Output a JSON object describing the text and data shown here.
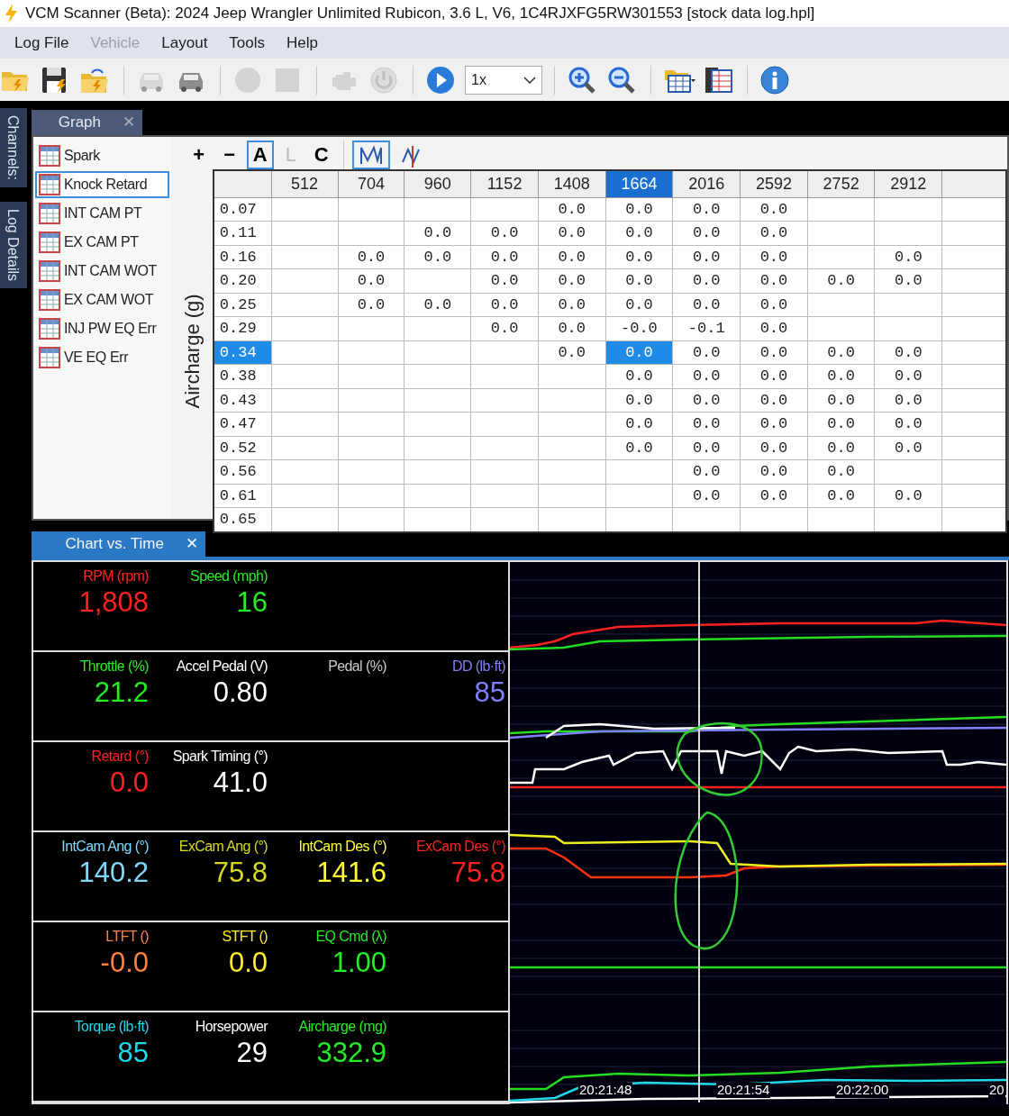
{
  "window": {
    "title": "VCM Scanner (Beta): 2024 Jeep Wrangler Unlimited Rubicon, 3.6 L, V6, 1C4RJXFG5RW301553 [stock data log.hpl]"
  },
  "menu": [
    {
      "label": "Log File",
      "disabled": false
    },
    {
      "label": "Vehicle",
      "disabled": true
    },
    {
      "label": "Layout",
      "disabled": false
    },
    {
      "label": "Tools",
      "disabled": false
    },
    {
      "label": "Help",
      "disabled": false
    }
  ],
  "toolbar": [
    {
      "kind": "open",
      "disabled": false
    },
    {
      "kind": "save",
      "disabled": false
    },
    {
      "kind": "reload",
      "disabled": false
    },
    {
      "kind": "separator"
    },
    {
      "kind": "car",
      "disabled": true
    },
    {
      "kind": "car",
      "disabled": false
    },
    {
      "kind": "separator"
    },
    {
      "kind": "record",
      "disabled": true
    },
    {
      "kind": "stop",
      "disabled": true
    },
    {
      "kind": "separator"
    },
    {
      "kind": "engine",
      "disabled": true
    },
    {
      "kind": "power",
      "disabled": true
    },
    {
      "kind": "separator"
    },
    {
      "kind": "play",
      "disabled": false
    },
    {
      "kind": "speed",
      "value": "1x"
    },
    {
      "kind": "separator"
    },
    {
      "kind": "zoom-in",
      "disabled": false
    },
    {
      "kind": "zoom-out",
      "disabled": false
    },
    {
      "kind": "separator"
    },
    {
      "kind": "layout",
      "disabled": false
    },
    {
      "kind": "table",
      "disabled": false
    },
    {
      "kind": "separator"
    },
    {
      "kind": "info",
      "disabled": false
    }
  ],
  "side_tabs": [
    {
      "label": "Channels:"
    },
    {
      "label": "Log Details"
    }
  ],
  "graph_panel": {
    "tab": {
      "label": "Graph",
      "close": "✕"
    },
    "tables": [
      {
        "label": "Spark",
        "selected": false
      },
      {
        "label": "Knock Retard",
        "selected": true
      },
      {
        "label": "INT CAM PT",
        "selected": false
      },
      {
        "label": "EX CAM PT",
        "selected": false
      },
      {
        "label": "INT CAM WOT",
        "selected": false
      },
      {
        "label": "EX CAM WOT",
        "selected": false
      },
      {
        "label": "INJ PW EQ Err",
        "selected": false
      },
      {
        "label": "VE EQ Err",
        "selected": false
      }
    ],
    "tools": [
      {
        "label": "+",
        "pressed": false,
        "disabled": false
      },
      {
        "label": "−",
        "pressed": false,
        "disabled": false
      },
      {
        "label": "A",
        "pressed": true,
        "disabled": false
      },
      {
        "label": "L",
        "pressed": false,
        "disabled": true
      },
      {
        "label": "C",
        "pressed": false,
        "disabled": false
      }
    ],
    "view_buttons": [
      {
        "kind": "line",
        "pressed": true
      },
      {
        "kind": "split",
        "pressed": false
      }
    ],
    "table": {
      "row_axis": "Aircharge (g)",
      "columns": [
        {
          "label": "512",
          "selected": false
        },
        {
          "label": "704",
          "selected": false
        },
        {
          "label": "960",
          "selected": false
        },
        {
          "label": "1152",
          "selected": false
        },
        {
          "label": "1408",
          "selected": false
        },
        {
          "label": "1664",
          "selected": true
        },
        {
          "label": "2016",
          "selected": false
        },
        {
          "label": "2592",
          "selected": false
        },
        {
          "label": "2752",
          "selected": false
        },
        {
          "label": "2912",
          "selected": false
        }
      ],
      "rows": [
        {
          "label": "0.07",
          "selected": false,
          "cells": [
            null,
            null,
            null,
            null,
            "0.0",
            "0.0",
            "0.0",
            "0.0",
            null,
            null
          ]
        },
        {
          "label": "0.11",
          "selected": false,
          "cells": [
            null,
            null,
            "0.0",
            "0.0",
            "0.0",
            "0.0",
            "0.0",
            "0.0",
            null,
            null
          ]
        },
        {
          "label": "0.16",
          "selected": false,
          "cells": [
            null,
            "0.0",
            "0.0",
            "0.0",
            "0.0",
            "0.0",
            "0.0",
            "0.0",
            null,
            "0.0"
          ]
        },
        {
          "label": "0.20",
          "selected": false,
          "cells": [
            null,
            "0.0",
            null,
            "0.0",
            "0.0",
            "0.0",
            "0.0",
            "0.0",
            "0.0",
            "0.0"
          ]
        },
        {
          "label": "0.25",
          "selected": false,
          "cells": [
            null,
            "0.0",
            "0.0",
            "0.0",
            "0.0",
            "0.0",
            "0.0",
            "0.0",
            null,
            null
          ]
        },
        {
          "label": "0.29",
          "selected": false,
          "cells": [
            null,
            null,
            null,
            "0.0",
            "0.0",
            "-0.0",
            "-0.1",
            "0.0",
            null,
            null
          ]
        },
        {
          "label": "0.34",
          "selected": true,
          "cells": [
            null,
            null,
            null,
            null,
            "0.0",
            "0.0",
            "0.0",
            "0.0",
            "0.0",
            "0.0"
          ]
        },
        {
          "label": "0.38",
          "selected": false,
          "cells": [
            null,
            null,
            null,
            null,
            null,
            "0.0",
            "0.0",
            "0.0",
            "0.0",
            "0.0"
          ]
        },
        {
          "label": "0.43",
          "selected": false,
          "cells": [
            null,
            null,
            null,
            null,
            null,
            "0.0",
            "0.0",
            "0.0",
            "0.0",
            "0.0"
          ]
        },
        {
          "label": "0.47",
          "selected": false,
          "cells": [
            null,
            null,
            null,
            null,
            null,
            "0.0",
            "0.0",
            "0.0",
            "0.0",
            "0.0"
          ]
        },
        {
          "label": "0.52",
          "selected": false,
          "cells": [
            null,
            null,
            null,
            null,
            null,
            "0.0",
            "0.0",
            "0.0",
            "0.0",
            "0.0"
          ]
        },
        {
          "label": "0.56",
          "selected": false,
          "cells": [
            null,
            null,
            null,
            null,
            null,
            null,
            "0.0",
            "0.0",
            "0.0",
            null
          ]
        },
        {
          "label": "0.61",
          "selected": false,
          "cells": [
            null,
            null,
            null,
            null,
            null,
            null,
            "0.0",
            "0.0",
            "0.0",
            "0.0"
          ]
        },
        {
          "label": "0.65",
          "selected": false,
          "cells": [
            null,
            null,
            null,
            null,
            null,
            null,
            null,
            null,
            null,
            null
          ]
        }
      ]
    }
  },
  "chart_panel": {
    "tab": {
      "label": "Chart vs. Time",
      "close": "✕"
    },
    "rows": [
      {
        "gauges": [
          {
            "label": "RPM (rpm)",
            "value": "1,808",
            "color": "#ff2020"
          },
          {
            "label": "Speed (mph)",
            "value": "16",
            "color": "#22ee22"
          }
        ]
      },
      {
        "gauges": [
          {
            "label": "Throttle (%)",
            "value": "21.2",
            "color": "#22ee22"
          },
          {
            "label": "Accel Pedal (V)",
            "value": "0.80",
            "color": "#ffffff"
          },
          {
            "label": "Pedal (%)",
            "color": "#c8c8c8"
          },
          {
            "label": "DD (lb·ft)",
            "value": "85",
            "color": "#8080ff"
          }
        ]
      },
      {
        "gauges": [
          {
            "label": "Retard (°)",
            "value": "0.0",
            "color": "#ff2020"
          },
          {
            "label": "Spark Timing (°)",
            "value": "41.0",
            "color": "#ffffff"
          }
        ]
      },
      {
        "gauges": [
          {
            "label": "IntCam Ang (°)",
            "value": "140.2",
            "color": "#80d8ff"
          },
          {
            "label": "ExCam Ang (°)",
            "value": "75.8",
            "color": "#d8d820"
          },
          {
            "label": "IntCam Des (°)",
            "value": "141.6",
            "color": "#ffff30"
          },
          {
            "label": "ExCam Des (°)",
            "value": "75.8",
            "color": "#ff2020"
          }
        ]
      },
      {
        "gauges": [
          {
            "label": "LTFT ()",
            "value": "-0.0",
            "color": "#ff8040"
          },
          {
            "label": "STFT ()",
            "value": "0.0",
            "color": "#ffee20"
          },
          {
            "label": "EQ Cmd (λ)",
            "value": "1.00",
            "color": "#22ee22"
          }
        ]
      },
      {
        "gauges": [
          {
            "label": "Torque (lb·ft)",
            "value": "85",
            "color": "#20d8e8"
          },
          {
            "label": "Horsepower",
            "value": "29",
            "color": "#ffffff"
          },
          {
            "label": "Aircharge (mg)",
            "value": "332.9",
            "color": "#22ee22"
          }
        ]
      }
    ],
    "time_labels": [
      "20:21:48",
      "20:21:54",
      "20:22:00",
      "20"
    ]
  }
}
